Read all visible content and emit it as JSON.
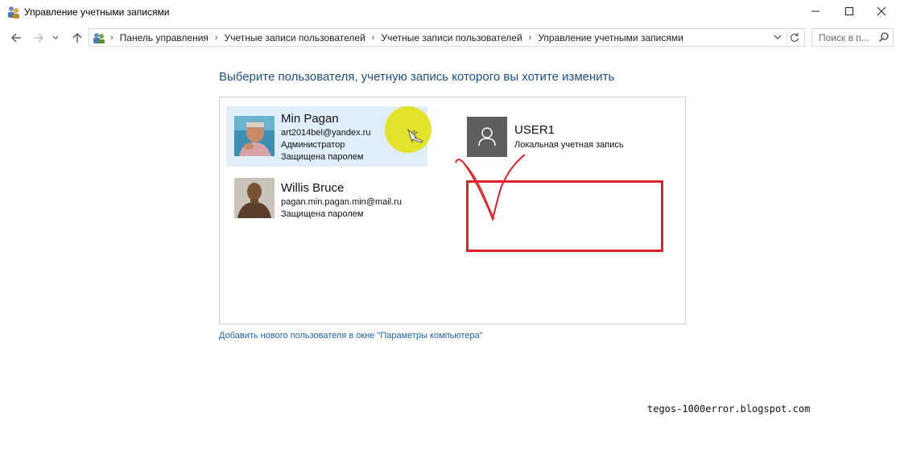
{
  "window": {
    "title": "Управление учетными записями"
  },
  "address_bar": {
    "crumbs": [
      "Панель управления",
      "Учетные записи пользователей",
      "Учетные записи пользователей",
      "Управление учетными записями"
    ]
  },
  "search": {
    "placeholder": "Поиск в п..."
  },
  "main": {
    "heading": "Выберите пользователя, учетную запись которого вы хотите изменить",
    "users": [
      {
        "name": "Min Pagan",
        "email": "art2014bel@yandex.ru",
        "role": "Администратор",
        "status": "Защищена паролем",
        "avatar": "photo-avatar"
      },
      {
        "name": "USER1",
        "type": "Локальная учетная запись",
        "avatar": "default-user-icon"
      },
      {
        "name": "Willis Bruce",
        "email": "pagan.min.pagan.min@mail.ru",
        "status": "Защищена паролем",
        "avatar": "photo-avatar"
      }
    ],
    "add_user_link": "Добавить нового пользователя в окне \"Параметры компьютера\""
  },
  "watermark": "tegos-1000error.blogspot.com",
  "colors": {
    "heading": "#1e4e8c",
    "link": "#1f62b5",
    "selected_bg": "#e0eefb",
    "annotation_red": "#e2202a",
    "cursor_highlight": "#e4e21a"
  }
}
